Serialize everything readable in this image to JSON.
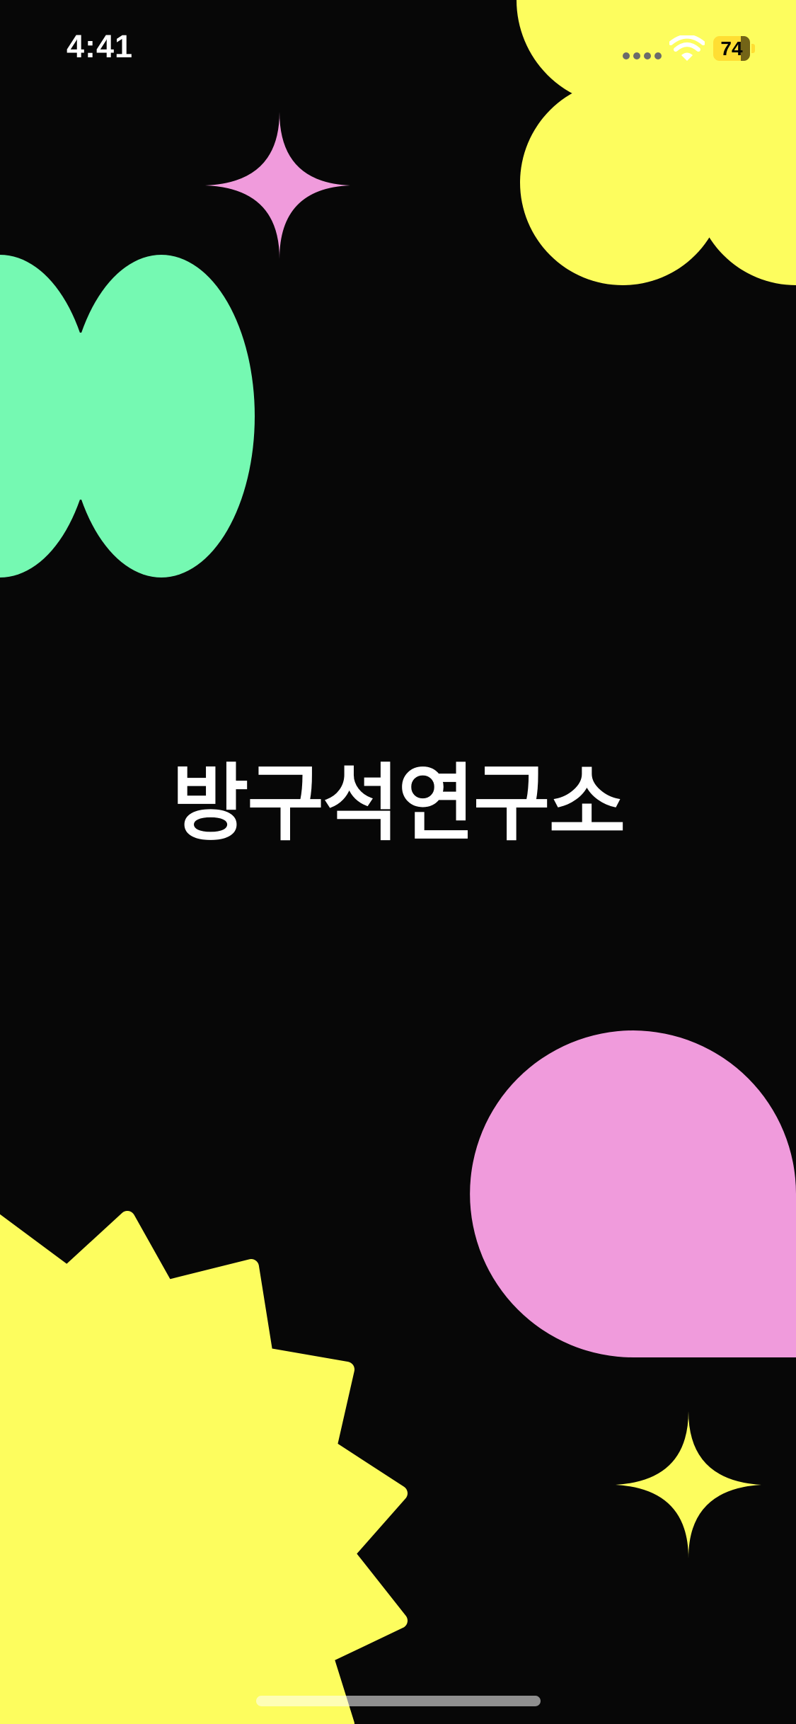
{
  "status_bar": {
    "time": "4:41",
    "battery_level": "74",
    "battery_color": "#ffde33",
    "wifi_icon": "wifi-icon",
    "signal_icon": "cellular-signal-icon"
  },
  "splash": {
    "title": "방구석연구소",
    "background_color": "#070707",
    "title_color": "#ffffff"
  },
  "decorations": {
    "colors": {
      "yellow": "#fdfd5e",
      "green": "#75f9b2",
      "pink": "#f09bdc"
    },
    "shapes": [
      "yellow-flower-shape",
      "pink-sparkle-shape",
      "green-double-oval-shape",
      "pink-teardrop-shape",
      "yellow-starburst-shape",
      "yellow-sparkle-shape"
    ]
  }
}
